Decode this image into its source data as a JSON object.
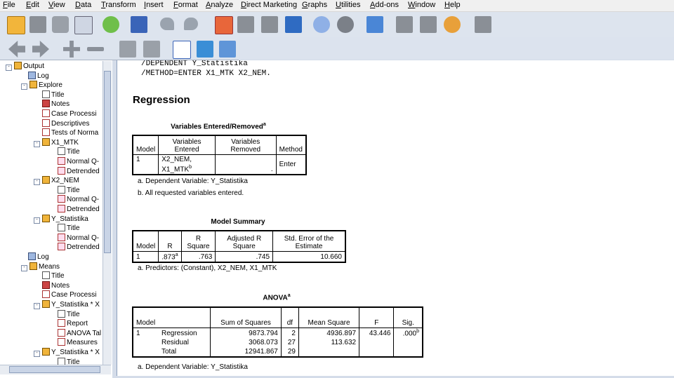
{
  "menu": [
    "File",
    "Edit",
    "View",
    "Data",
    "Transform",
    "Insert",
    "Format",
    "Analyze",
    "Direct Marketing",
    "Graphs",
    "Utilities",
    "Add-ons",
    "Window",
    "Help"
  ],
  "colors": {
    "accent": "#f0b43a",
    "pane_border": "#8da0bd",
    "toolbar": "#dde4ee"
  },
  "toolbar_icons": [
    "open-icon",
    "save-icon",
    "print-icon",
    "print-preview-icon",
    "export-icon",
    "recall-dialog-icon",
    "undo-icon",
    "redo-icon",
    "goto-data-icon",
    "goto-case-icon",
    "goto-variable-icon",
    "variables-icon",
    "use-sets-icon",
    "show-all-icon",
    "split-file-icon",
    "weight-icon",
    "select-cases-icon",
    "value-labels-icon",
    "spell-icon",
    "designate-window-icon"
  ],
  "toolbar2_icons": [
    "back-icon",
    "forward-icon",
    "expand-icon",
    "collapse-icon",
    "show-icon",
    "hide-icon",
    "insert-heading-icon",
    "insert-title-icon",
    "insert-text-icon"
  ],
  "tree": [
    {
      "label": "Output",
      "icon": "book",
      "depth": 0,
      "exp": "-"
    },
    {
      "label": "Log",
      "icon": "log",
      "depth": 1
    },
    {
      "label": "Explore",
      "icon": "book",
      "depth": 1,
      "exp": "-"
    },
    {
      "label": "Title",
      "icon": "page",
      "depth": 2
    },
    {
      "label": "Notes",
      "icon": "notes",
      "depth": 2
    },
    {
      "label": "Case Processi",
      "icon": "table",
      "depth": 2
    },
    {
      "label": "Descriptives",
      "icon": "table",
      "depth": 2
    },
    {
      "label": "Tests of Norma",
      "icon": "table",
      "depth": 2
    },
    {
      "label": "X1_MTK",
      "icon": "book",
      "depth": 2,
      "exp": "-"
    },
    {
      "label": "Title",
      "icon": "page",
      "depth": 3
    },
    {
      "label": "Normal Q-",
      "icon": "chart",
      "depth": 3
    },
    {
      "label": "Detrended",
      "icon": "chart",
      "depth": 3
    },
    {
      "label": "X2_NEM",
      "icon": "book",
      "depth": 2,
      "exp": "-"
    },
    {
      "label": "Title",
      "icon": "page",
      "depth": 3
    },
    {
      "label": "Normal Q-",
      "icon": "chart",
      "depth": 3
    },
    {
      "label": "Detrended",
      "icon": "chart",
      "depth": 3
    },
    {
      "label": "Y_Statistika",
      "icon": "book",
      "depth": 2,
      "exp": "-"
    },
    {
      "label": "Title",
      "icon": "page",
      "depth": 3
    },
    {
      "label": "Normal Q-",
      "icon": "chart",
      "depth": 3
    },
    {
      "label": "Detrended",
      "icon": "chart",
      "depth": 3
    },
    {
      "label": "Log",
      "icon": "log",
      "depth": 1
    },
    {
      "label": "Means",
      "icon": "book",
      "depth": 1,
      "exp": "-"
    },
    {
      "label": "Title",
      "icon": "page",
      "depth": 2
    },
    {
      "label": "Notes",
      "icon": "notes",
      "depth": 2
    },
    {
      "label": "Case Processi",
      "icon": "table",
      "depth": 2
    },
    {
      "label": "Y_Statistika  * X",
      "icon": "book",
      "depth": 2,
      "exp": "-"
    },
    {
      "label": "Title",
      "icon": "page",
      "depth": 3
    },
    {
      "label": "Report",
      "icon": "table",
      "depth": 3
    },
    {
      "label": "ANOVA Tal",
      "icon": "table",
      "depth": 3
    },
    {
      "label": "Measures",
      "icon": "table",
      "depth": 3
    },
    {
      "label": "Y_Statistika  * X",
      "icon": "book",
      "depth": 2,
      "exp": "-"
    },
    {
      "label": "Title",
      "icon": "page",
      "depth": 3
    }
  ],
  "syntax": [
    "/DEPENDENT Y_Statistika",
    "/METHOD=ENTER X1_MTK X2_NEM."
  ],
  "heading": "Regression",
  "ver": {
    "title": "Variables Entered/Removed",
    "sup": "a",
    "h_model": "Model",
    "h_entered": "Variables Entered",
    "h_removed": "Variables Removed",
    "h_method": "Method",
    "model": "1",
    "entered_1": "X2_NEM,",
    "entered_2": "X1_MTK",
    "entered_sup": "b",
    "removed": ".",
    "method": "Enter",
    "foot_a": "a. Dependent Variable: Y_Statistika",
    "foot_b": "b. All requested variables entered."
  },
  "ms": {
    "title": "Model Summary",
    "h_model": "Model",
    "h_r": "R",
    "h_rsq": "R Square",
    "h_adj": "Adjusted R Square",
    "h_se": "Std. Error of the Estimate",
    "model": "1",
    "r": ".873",
    "r_sup": "a",
    "rsq": ".763",
    "adj": ".745",
    "se": "10.660",
    "foot": "a. Predictors: (Constant), X2_NEM, X1_MTK"
  },
  "anova": {
    "title": "ANOVA",
    "sup": "a",
    "h_model": "Model",
    "h_ss": "Sum of Squares",
    "h_df": "df",
    "h_ms": "Mean Square",
    "h_f": "F",
    "h_sig": "Sig.",
    "model": "1",
    "reg": "Regression",
    "reg_ss": "9873.794",
    "reg_df": "2",
    "reg_ms": "4936.897",
    "f": "43.446",
    "sig": ".000",
    "sig_sup": "b",
    "res": "Residual",
    "res_ss": "3068.073",
    "res_df": "27",
    "res_ms": "113.632",
    "tot": "Total",
    "tot_ss": "12941.867",
    "tot_df": "29",
    "foot": "a. Dependent Variable: Y_Statistika"
  }
}
